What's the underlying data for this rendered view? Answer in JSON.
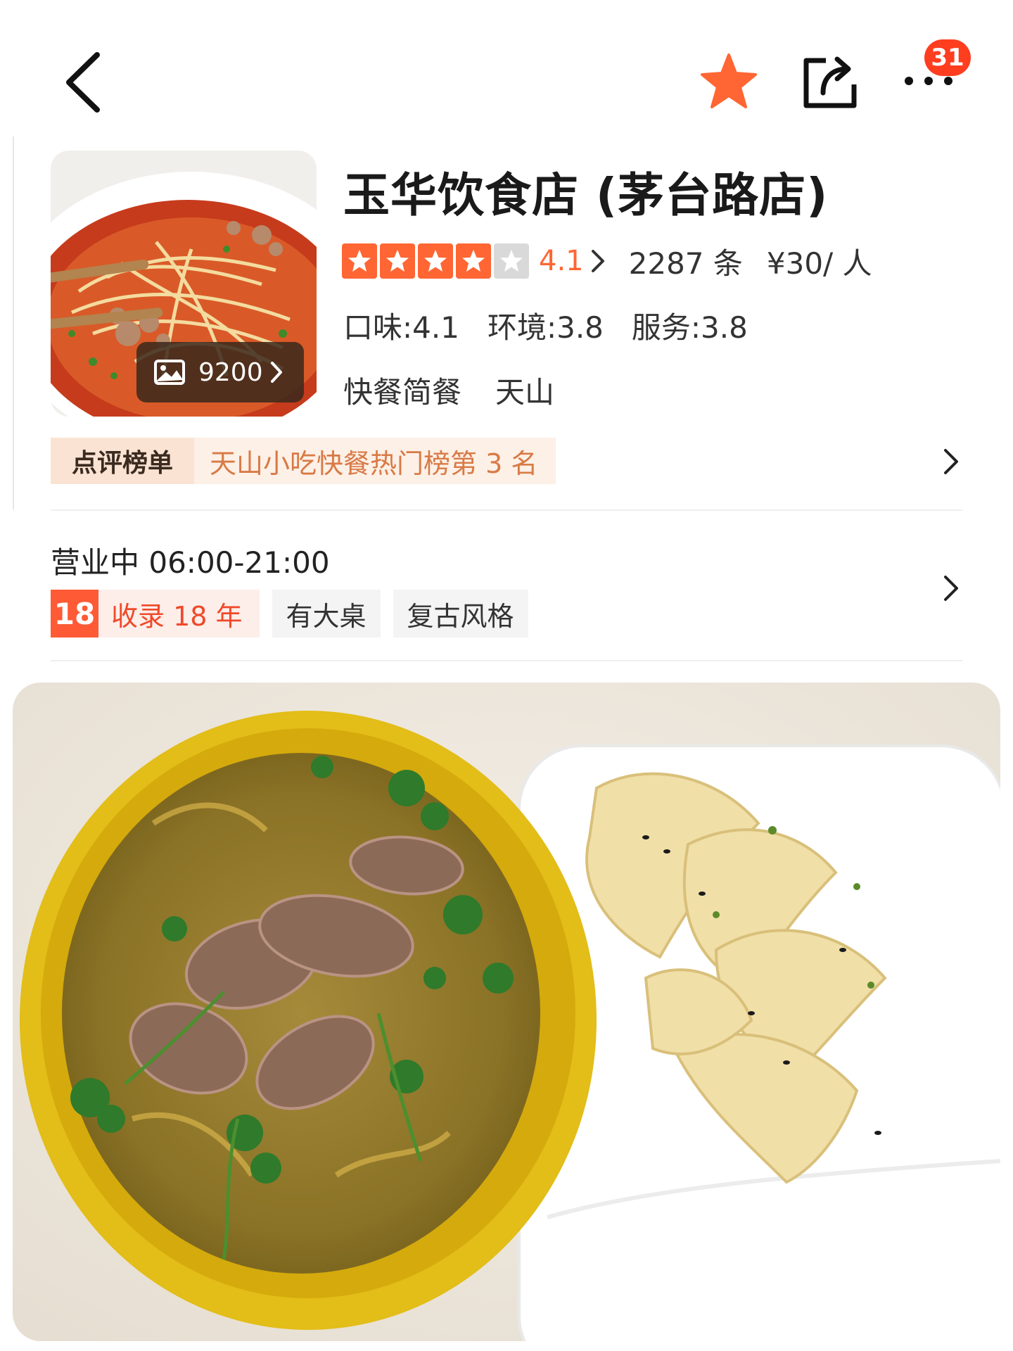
{
  "nav": {
    "back_icon": "chevron-left-icon",
    "favorite_icon": "star-icon",
    "share_icon": "share-icon",
    "more_icon": "more-dots-icon",
    "notification_count": "31",
    "accent_color": "#ff6633",
    "badge_color": "#ff3d1f"
  },
  "shop": {
    "name": "玉华饮食店 (茅台路店)",
    "photo_count": "9200",
    "rating": {
      "stars_filled": 4,
      "stars_total": 5,
      "score": "4.1",
      "review_count": "2287 条",
      "price": "¥30/ 人"
    },
    "subscores": [
      "口味:4.1",
      "环境:3.8",
      "服务:3.8"
    ],
    "tags": [
      "快餐简餐",
      "天山"
    ],
    "rank": {
      "label": "点评榜单",
      "text": "天山小吃快餐热门榜第 3 名"
    }
  },
  "info": {
    "hours": "营业中 06:00-21:00",
    "years_number": "18",
    "years_text": "收录 18 年",
    "features": [
      "有大桌",
      "复古风格"
    ]
  },
  "food_photo": {
    "subject": "beef noodle soup and pan-fried dumplings"
  }
}
